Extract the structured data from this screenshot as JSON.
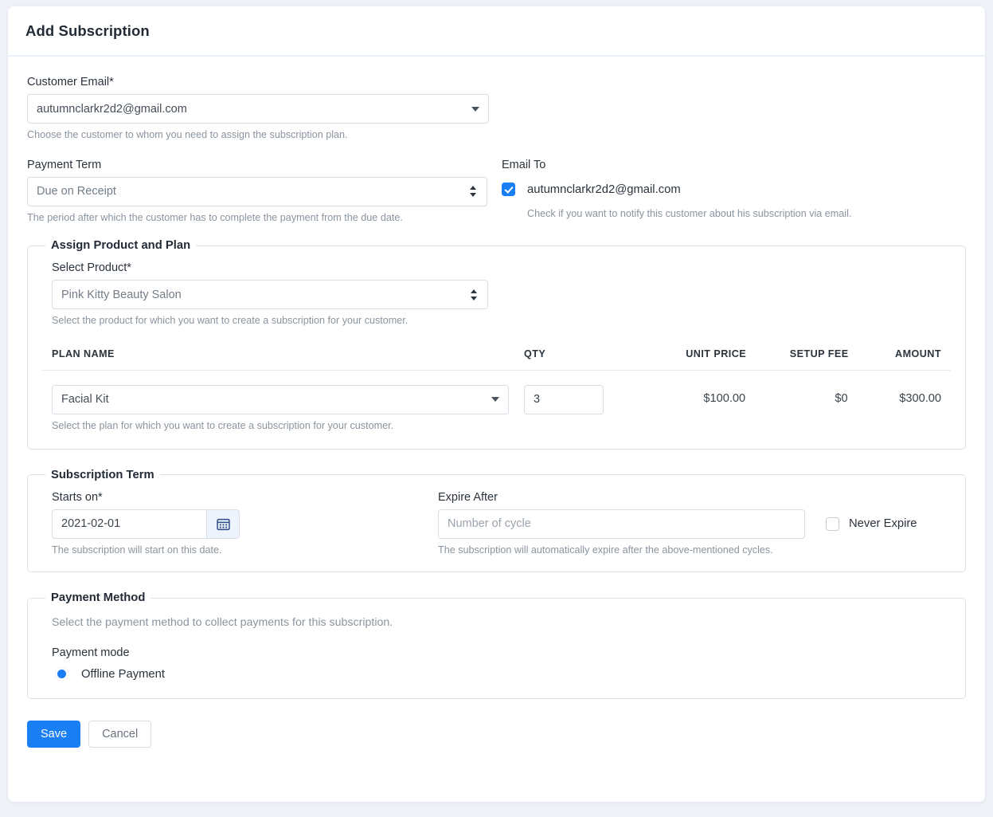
{
  "header": {
    "title": "Add Subscription"
  },
  "customer": {
    "label": "Customer Email*",
    "value": "autumnclarkr2d2@gmail.com",
    "hint": "Choose the customer to whom you need to assign the subscription plan."
  },
  "payment_term": {
    "label": "Payment Term",
    "value": "Due on Receipt",
    "hint": "The period after which the customer has to complete the payment from the due date."
  },
  "email_to": {
    "label": "Email To",
    "address": "autumnclarkr2d2@gmail.com",
    "checked": true,
    "hint": "Check if you want to notify this customer about his subscription via email."
  },
  "assign_product": {
    "legend": "Assign Product and Plan",
    "product_label": "Select Product*",
    "product_value": "Pink Kitty Beauty Salon",
    "product_hint": "Select the product for which you want to create a subscription for your customer.",
    "columns": [
      "PLAN NAME",
      "QTY",
      "UNIT PRICE",
      "SETUP FEE",
      "AMOUNT"
    ],
    "rows": [
      {
        "plan_name": "Facial Kit",
        "qty": "3",
        "unit_price": "$100.00",
        "setup_fee": "$0",
        "amount": "$300.00"
      }
    ],
    "plan_hint": "Select the plan for which you want to create a subscription for your customer."
  },
  "subscription_term": {
    "legend": "Subscription Term",
    "starts_on_label": "Starts on*",
    "starts_on_value": "2021-02-01",
    "starts_on_hint": "The subscription will start on this date.",
    "expire_after_label": "Expire After",
    "expire_after_placeholder": "Number of cycle",
    "expire_after_hint": "The subscription will automatically expire after the above-mentioned cycles.",
    "never_expire_label": "Never Expire",
    "never_expire_checked": false
  },
  "payment_method": {
    "legend": "Payment Method",
    "description": "Select the payment method to collect payments for this subscription.",
    "mode_label": "Payment mode",
    "options": [
      {
        "label": "Offline Payment",
        "selected": true
      }
    ]
  },
  "footer": {
    "save_label": "Save",
    "cancel_label": "Cancel"
  },
  "colors": {
    "accent": "#1a7ef5",
    "page_bg": "#eff3f8",
    "card_bg": "#ffffff",
    "border": "#d8dee6"
  }
}
